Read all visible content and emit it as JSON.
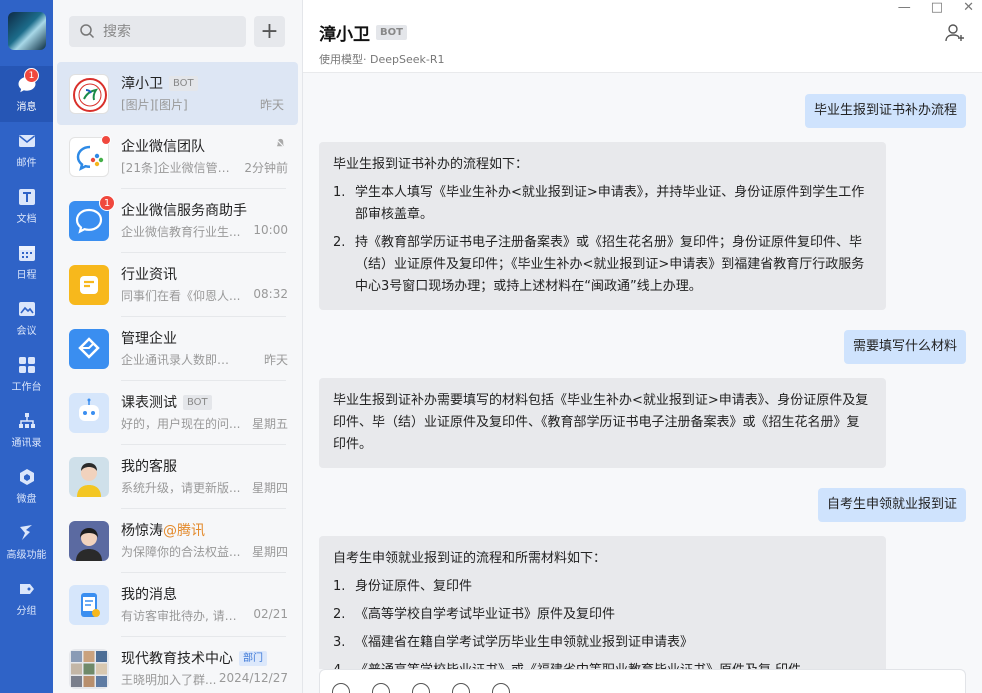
{
  "nav": {
    "items": [
      {
        "label": "消息",
        "icon": "chat-bubble-icon",
        "badge": "1",
        "active": true
      },
      {
        "label": "邮件",
        "icon": "mail-icon"
      },
      {
        "label": "文档",
        "icon": "document-icon"
      },
      {
        "label": "日程",
        "icon": "calendar-icon"
      },
      {
        "label": "会议",
        "icon": "meeting-icon"
      },
      {
        "label": "工作台",
        "icon": "workbench-icon"
      },
      {
        "label": "通讯录",
        "icon": "contacts-icon"
      },
      {
        "label": "微盘",
        "icon": "cloud-drive-icon"
      },
      {
        "label": "高级功能",
        "icon": "advanced-icon"
      },
      {
        "label": "分组",
        "icon": "group-tag-icon"
      }
    ]
  },
  "search": {
    "placeholder": "搜索",
    "add": "+"
  },
  "conversations": [
    {
      "name": "漳小卫",
      "tag": "BOT",
      "preview": "[图片][图片]",
      "time": "昨天"
    },
    {
      "name": "企业微信团队",
      "preview": "[21条]企业微信管理...",
      "time": "2分钟前"
    },
    {
      "name": "企业微信服务商助手",
      "badge": "1",
      "preview": "企业微信教育行业生...",
      "time": "10:00"
    },
    {
      "name": "行业资讯",
      "preview": "同事们在看《仰恩人...",
      "time": "08:32"
    },
    {
      "name": "管理企业",
      "preview": "企业通讯录人数即将达...",
      "time": "昨天"
    },
    {
      "name": "课表测试",
      "tag": "BOT",
      "preview": "好的，用户现在的问...",
      "time": "星期五"
    },
    {
      "name": "我的客服",
      "preview": "系统升级，请更新版...",
      "time": "星期四"
    },
    {
      "name": "杨惊涛",
      "org": "@腾讯",
      "preview": "为保障你的合法权益...",
      "time": "星期四"
    },
    {
      "name": "我的消息",
      "preview": "有访客审批待办, 请前...",
      "time": "02/21"
    },
    {
      "name": "现代教育技术中心",
      "tag": "部门",
      "preview": "王晓明加入了群...",
      "time": "2024/12/27"
    }
  ],
  "chat": {
    "title": "漳小卫",
    "tag": "BOT",
    "subtitle": "使用模型· DeepSeek-R1",
    "messages": {
      "q1": "毕业生报到证书补办流程",
      "a1": {
        "intro": "毕业生报到证书补办的流程如下：",
        "items": [
          {
            "n": "1.",
            "text": "学生本人填写《毕业生补办<就业报到证>申请表》，并持毕业证、身份证原件到学生工作部审核盖章。"
          },
          {
            "n": "2.",
            "text": "持《教育部学历证书电子注册备案表》或《招生花名册》复印件；身份证原件复印件、毕（结）业证原件及复印件；《毕业生补办<就业报到证>申请表》到福建省教育厅行政服务中心3号窗口现场办理；或持上述材料在“闽政通”线上办理。"
          }
        ]
      },
      "q2": "需要填写什么材料",
      "a2": "毕业生报到证补办需要填写的材料包括《毕业生补办<就业报到证>申请表》、身份证原件及复印件、毕（结）业证原件及复印件、《教育部学历证书电子注册备案表》或《招生花名册》复印件。",
      "q3": "自考生申领就业报到证",
      "a3": {
        "intro": "自考生申领就业报到证的流程和所需材料如下：",
        "items": [
          {
            "n": "1.",
            "text": "身份证原件、复印件"
          },
          {
            "n": "2.",
            "text": "《高等学校自学考试毕业证书》原件及复印件"
          },
          {
            "n": "3.",
            "text": "《福建省在籍自学考试学历毕业生申领就业报到证申请表》"
          },
          {
            "n": "4.",
            "text": "《普通高等学校毕业证书》或《福建省中等职业教育毕业证书》原件及复 印件"
          }
        ]
      }
    }
  },
  "colors": {
    "rail": "#2f63c7",
    "outgoing": "#cfe3fd",
    "incoming": "#e8e9ec",
    "badge": "#f0483e"
  }
}
